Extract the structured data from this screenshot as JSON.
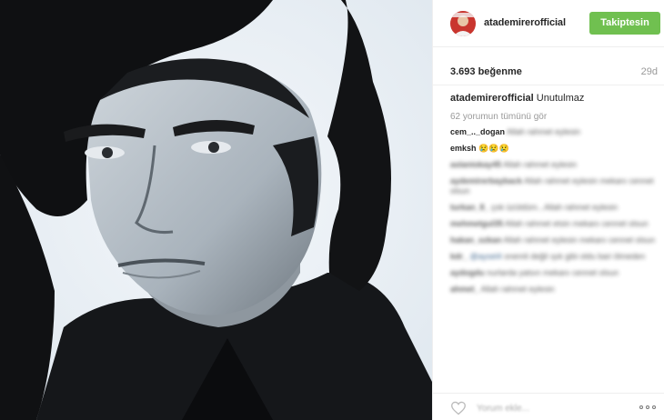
{
  "post": {
    "photo_label": "",
    "author": {
      "username": "atademirerofficial",
      "follow_label": "Takiptesin"
    },
    "likes": "3.693 beğenme",
    "age": "29d",
    "caption": {
      "username": "atademirerofficial",
      "text": "Unutulmaz"
    },
    "view_all_comments": "62 yorumun tümünü gör",
    "comments": [
      {
        "user": "cem_.._dogan",
        "text": "Allah rahmet eylesin"
      },
      {
        "user": "emksh",
        "text": "😢😢😢"
      },
      {
        "user": "aslaniokay45",
        "text": "Allah rahmet eylesin"
      },
      {
        "user": "aydemirerbayback",
        "text": "Allah rahmet eylesin mekanı cennet olsun"
      },
      {
        "user": "turkan_8_",
        "text": "çok üzüldüm...Allah rahmet eylesin"
      },
      {
        "user": "mehmetgul35",
        "text": "Allah rahmet etsin mekanı cennet olsun"
      },
      {
        "user": "hakan_ozkan",
        "text": "Allah rahmet eylesin mekanı cennet olsun"
      },
      {
        "user": "kdr_",
        "tag": "@aysel4",
        "text": "onemli değil ışık gibi oldu bari ölmeden"
      },
      {
        "user": "aydogdu",
        "text": "nurlarda yatsın mekanı cennet olsun"
      },
      {
        "user": "ahmet_",
        "text": "Allah rahmet eylesin"
      }
    ],
    "add_comment_placeholder": "Yorum ekle...",
    "colors": {
      "follow_button": "#70c050",
      "muted_text": "#999999",
      "divider": "#efefef"
    },
    "icons": {
      "like": "heart-outline-icon",
      "options": "more-options-icon"
    }
  }
}
